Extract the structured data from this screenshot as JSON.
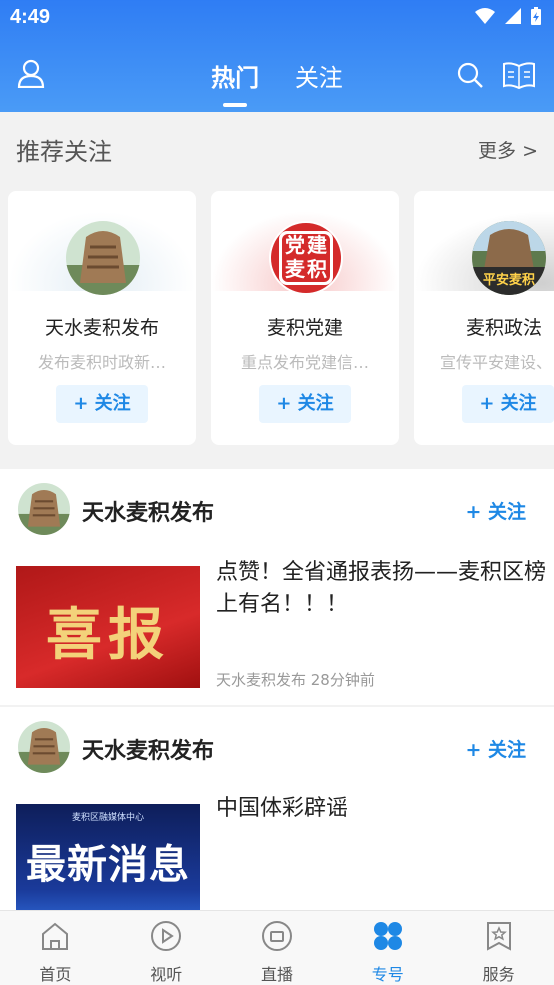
{
  "status": {
    "time": "4:49"
  },
  "header": {
    "tabs": [
      "热门",
      "关注"
    ]
  },
  "recommend": {
    "title": "推荐关注",
    "more": "更多 >",
    "cards": [
      {
        "name": "天水麦积发布",
        "desc": "发布麦积时政新…",
        "follow": "+ 关注"
      },
      {
        "name": "麦积党建",
        "desc": "重点发布党建信…",
        "follow": "+ 关注"
      },
      {
        "name": "麦积政法",
        "desc": "宣传平安建设、",
        "follow": "+ 关注"
      }
    ],
    "badge_party": "党建麦积",
    "badge_law": "平安麦积"
  },
  "posts": [
    {
      "author": "天水麦积发布",
      "follow": "+ 关注",
      "title": "点赞！全省通报表扬——麦积区榜上有名！！！",
      "meta": "天水麦积发布   28分钟前",
      "image_text": "喜报"
    },
    {
      "author": "天水麦积发布",
      "follow": "+ 关注",
      "title": "中国体彩辟谣",
      "image_caption": "麦积区融媒体中心",
      "image_text": "最新消息"
    }
  ],
  "nav": [
    {
      "label": "首页",
      "icon": "home-icon"
    },
    {
      "label": "视听",
      "icon": "play-icon"
    },
    {
      "label": "直播",
      "icon": "tv-icon"
    },
    {
      "label": "专号",
      "icon": "grid-icon",
      "active": true
    },
    {
      "label": "服务",
      "icon": "service-icon"
    }
  ],
  "colors": {
    "header": "#2f7df4",
    "accent": "#1e88e5"
  }
}
